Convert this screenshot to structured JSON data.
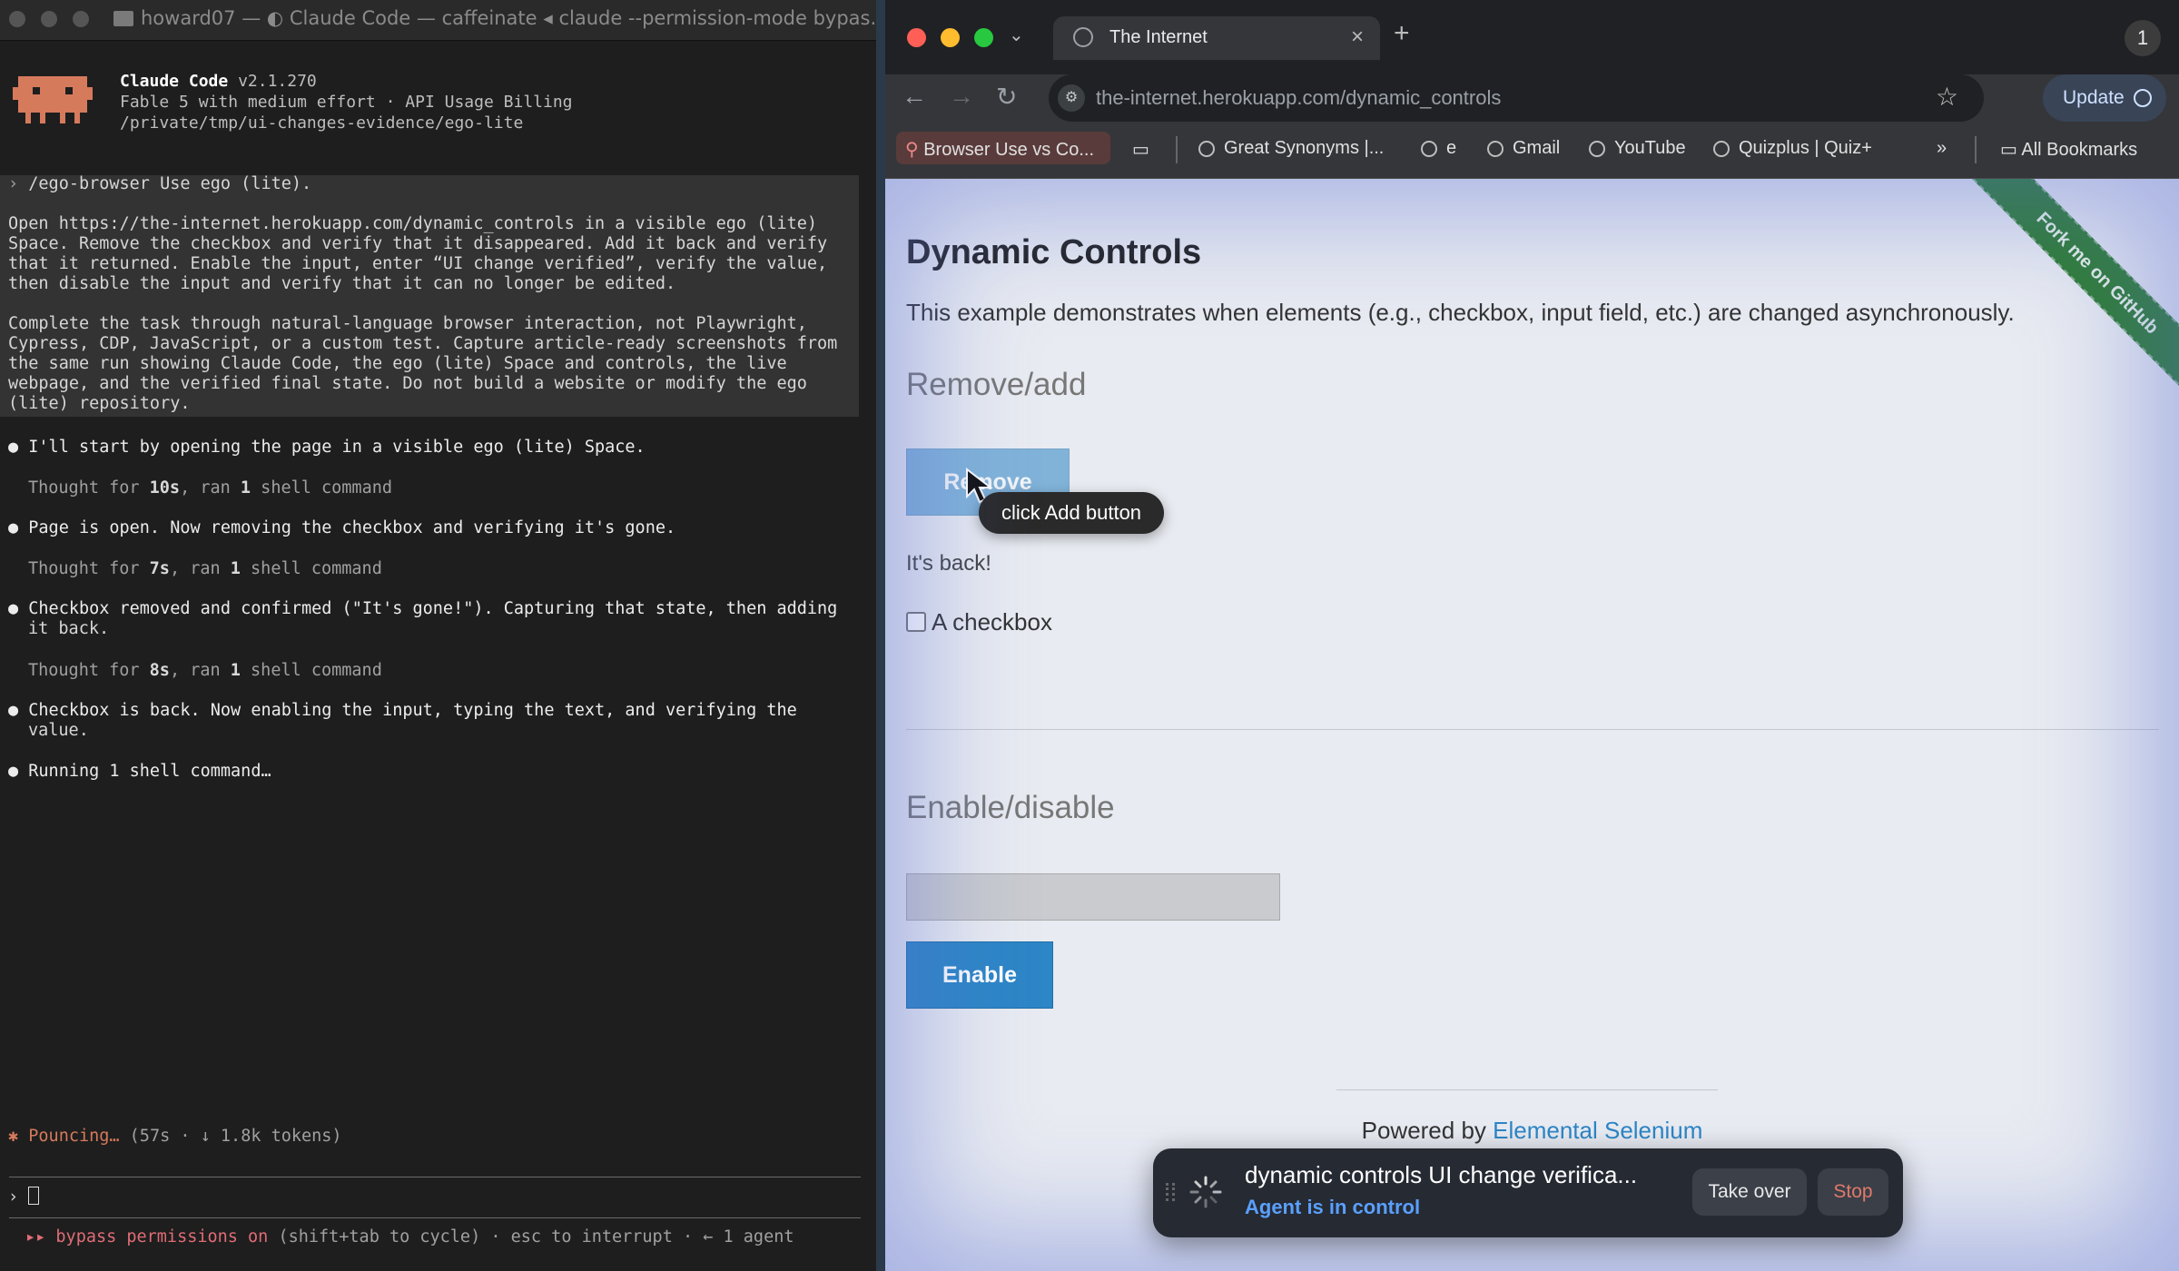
{
  "terminal": {
    "title": "howard07 — ◐ Claude Code — caffeinate ◂ claude --permission-mode bypas...",
    "app_name": "Claude Code",
    "version": "v2.1.270",
    "model_line": "Fable 5 with medium effort · API Usage Billing",
    "cwd": "/private/tmp/ui-changes-evidence/ego-lite",
    "prompt_command": "/ego-browser Use ego (lite).",
    "prompt_para1": [
      "Open https://the-internet.herokuapp.com/dynamic_controls in a visible ego (lite)",
      "Space. Remove the checkbox and verify that it disappeared. Add it back and verify",
      "that it returned. Enable the input, enter “UI change verified”, verify the value,",
      "then disable the input and verify that it can no longer be edited."
    ],
    "prompt_para2": [
      "Complete the task through natural-language browser interaction, not Playwright,",
      "Cypress, CDP, JavaScript, or a custom test. Capture article-ready screenshots from",
      "the same run showing Claude Code, the ego (lite) Space and controls, the live",
      "webpage, and the verified final state. Do not build a website or modify the ego",
      "(lite) repository."
    ],
    "steps": [
      {
        "bullet": "I'll start by opening the page in a visible ego (lite) Space.",
        "thought": [
          "Thought for ",
          "10s",
          ", ran ",
          "1",
          " shell command"
        ]
      },
      {
        "bullet": "Page is open. Now removing the checkbox and verifying it's gone.",
        "thought": [
          "Thought for ",
          "7s",
          ", ran ",
          "1",
          " shell command"
        ]
      },
      {
        "bullet": "Checkbox removed and confirmed (\"It's gone!\"). Capturing that state, then adding",
        "bullet2": "it back.",
        "thought": [
          "Thought for ",
          "8s",
          ", ran ",
          "1",
          " shell command"
        ]
      },
      {
        "bullet": "Checkbox is back. Now enabling the input, typing the text, and verifying the",
        "bullet2": "value."
      }
    ],
    "running": "Running 1 shell command…",
    "spinner": "✱ Pouncing…",
    "spinner_stats": "(57s · ↓ 1.8k tokens)",
    "input_prompt": "›",
    "bypass": "▸▸ bypass permissions on",
    "bypass_hint": "(shift+tab to cycle) · esc to interrupt · ← 1 agent"
  },
  "browser": {
    "tab_title": "The Internet",
    "profile_count": "1",
    "url": "the-internet.herokuapp.com/dynamic_controls",
    "update_label": "Update",
    "bookmarks": [
      "Browser Use vs Co...",
      "Great Synonyms |...",
      "e",
      "Gmail",
      "YouTube",
      "Quizplus | Quiz+",
      "All Bookmarks"
    ]
  },
  "page": {
    "title": "Dynamic Controls",
    "description": "This example demonstrates when elements (e.g., checkbox, input field, etc.) are changed asynchronously.",
    "section1": "Remove/add",
    "remove_label": "Remove",
    "tooltip": "click Add button",
    "message": "It's back!",
    "checkbox_label": "A checkbox",
    "section2": "Enable/disable",
    "enable_label": "Enable",
    "footer_prefix": "Powered by ",
    "footer_link": "Elemental Selenium",
    "ribbon": "Fork me on GitHub"
  },
  "agent": {
    "title": "dynamic controls UI change verifica...",
    "status": "Agent is in control",
    "takeover": "Take over",
    "stop": "Stop"
  }
}
